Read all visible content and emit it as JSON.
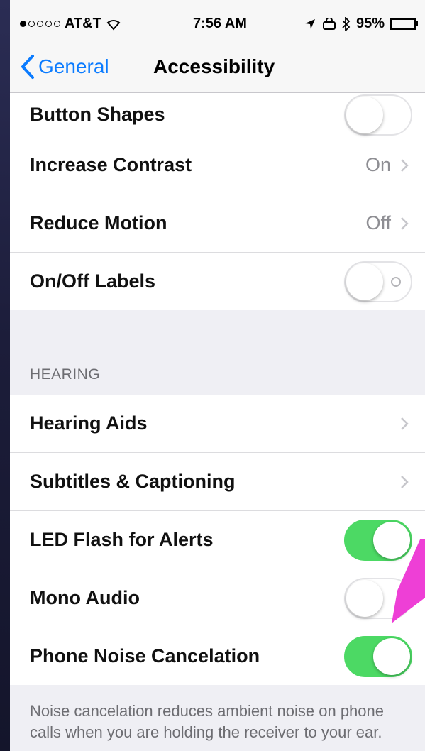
{
  "status_bar": {
    "carrier": "AT&T",
    "time": "7:56 AM",
    "battery": "95%",
    "battery_level": 0.95
  },
  "nav": {
    "back_label": "General",
    "title": "Accessibility"
  },
  "top_group": {
    "rows": [
      {
        "label": "Button Shapes",
        "toggle": false
      },
      {
        "label": "Increase Contrast",
        "value": "On"
      },
      {
        "label": "Reduce Motion",
        "value": "Off"
      },
      {
        "label": "On/Off Labels",
        "toggle": false
      }
    ]
  },
  "hearing": {
    "header": "HEARING",
    "rows": [
      {
        "label": "Hearing Aids"
      },
      {
        "label": "Subtitles & Captioning"
      },
      {
        "label": "LED Flash for Alerts",
        "toggle": true
      },
      {
        "label": "Mono Audio",
        "toggle": false
      },
      {
        "label": "Phone Noise Cancelation",
        "toggle": true
      }
    ],
    "footer": "Noise cancelation reduces ambient noise on phone calls when you are holding the receiver to your ear."
  },
  "colors": {
    "accent": "#0a7bff",
    "toggle_on": "#4cd964",
    "arrow": "#ee3fd6"
  }
}
